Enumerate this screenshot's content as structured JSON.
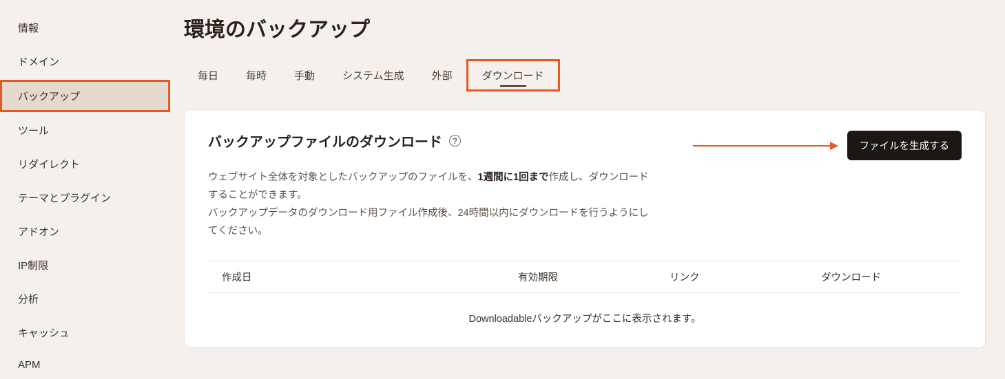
{
  "sidebar": {
    "items": [
      {
        "label": "情報"
      },
      {
        "label": "ドメイン"
      },
      {
        "label": "バックアップ",
        "active": true
      },
      {
        "label": "ツール"
      },
      {
        "label": "リダイレクト"
      },
      {
        "label": "テーマとプラグイン"
      },
      {
        "label": "アドオン"
      },
      {
        "label": "IP制限"
      },
      {
        "label": "分析"
      },
      {
        "label": "キャッシュ"
      },
      {
        "label": "APM"
      }
    ]
  },
  "page": {
    "title": "環境のバックアップ"
  },
  "tabs": [
    {
      "label": "毎日"
    },
    {
      "label": "毎時"
    },
    {
      "label": "手動"
    },
    {
      "label": "システム生成"
    },
    {
      "label": "外部"
    },
    {
      "label": "ダウンロード",
      "selected": true
    }
  ],
  "card": {
    "title": "バックアップファイルのダウンロード",
    "help_glyph": "?",
    "desc_part1": "ウェブサイト全体を対象としたバックアップのファイルを、",
    "desc_bold": "1週間に1回まで",
    "desc_part2": "作成し、ダウンロードすることができます。",
    "desc_line2": "バックアップデータのダウンロード用ファイル作成後、24時間以内にダウンロードを行うようにしてください。",
    "button_label": "ファイルを生成する"
  },
  "table": {
    "columns": {
      "created": "作成日",
      "expires": "有効期限",
      "link": "リンク",
      "download": "ダウンロード"
    },
    "empty_message": "Downloadableバックアップがここに表示されます。"
  }
}
